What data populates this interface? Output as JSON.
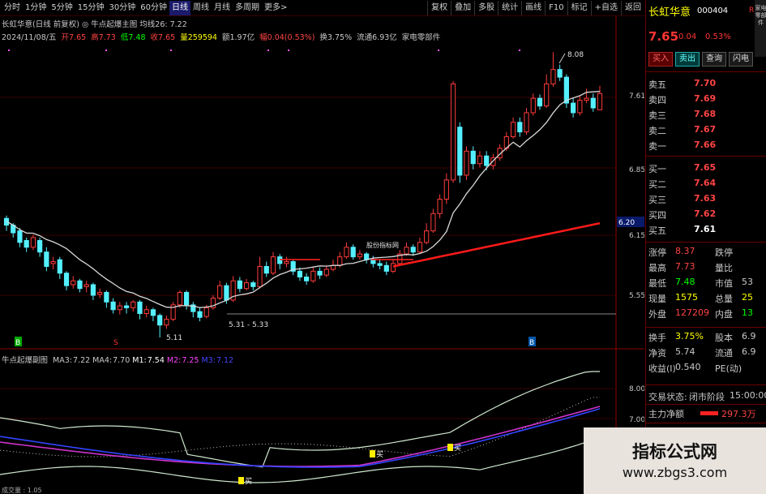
{
  "toolbar": {
    "timeframes": [
      "分时",
      "1分钟",
      "5分钟",
      "15分钟",
      "30分钟",
      "60分钟",
      "日线",
      "周线",
      "月线",
      "多周期",
      "更多>"
    ],
    "active_timeframe": "日线",
    "tools": [
      "复权",
      "叠加",
      "多股",
      "统计",
      "画线",
      "F10",
      "标记",
      "+自选",
      "返回"
    ]
  },
  "main_chart": {
    "header_line": "长虹华意(日线 前复权) ◎ 牛点起爆主图 均线26: 7.22",
    "date": "2024/11/08/五",
    "ohlc": [
      {
        "label": "开",
        "value": "7.65",
        "color": "#ff4444"
      },
      {
        "label": "高",
        "value": "7.73",
        "color": "#ff4444"
      },
      {
        "label": "低",
        "value": "7.48",
        "color": "#00ff00"
      },
      {
        "label": "收",
        "value": "7.65",
        "color": "#ff4444"
      },
      {
        "label": "量",
        "value": "259594",
        "color": "#ffff00"
      },
      {
        "label": "额",
        "value": "1.97亿",
        "color": "#c8c8c8"
      },
      {
        "label": "幅",
        "value": "0.04(0.53%)",
        "color": "#ff4444"
      },
      {
        "label": "换",
        "value": "3.75%",
        "color": "#c8c8c8"
      },
      {
        "label": "流通",
        "value": "6.93亿",
        "color": "#c8c8c8"
      }
    ],
    "industry": "家电零部件",
    "annotations": {
      "high_label": "8.08",
      "low_label": "5.11",
      "range_label": "5.31 - 5.33",
      "signal_label": "股份指标网",
      "marker_left_b": "B",
      "marker_left_s": "S",
      "marker_right_b": "B",
      "price_tag": "6.20"
    },
    "price_axis_labels": [
      "7.61",
      "6.85",
      "6.15",
      "5.55"
    ]
  },
  "sub_chart": {
    "title": "牛点起爆副图",
    "legend": [
      {
        "label": "MA3:",
        "value": "7.22",
        "color": "#c8c8c8"
      },
      {
        "label": "MA4:",
        "value": "7.70",
        "color": "#c8c8c8"
      },
      {
        "label": "M1:",
        "value": "7.54",
        "color": "#ffffff"
      },
      {
        "label": "M2:",
        "value": "7.25",
        "color": "#ff44ff"
      },
      {
        "label": "M3:",
        "value": "7.12",
        "color": "#4444ff"
      }
    ],
    "axis_labels": [
      "8.00",
      "7.00"
    ],
    "signal_text": "买",
    "bottom_text": "成交量 : 1.05"
  },
  "quote_panel": {
    "stock_name": "长虹华意",
    "stock_code": "000404",
    "r_mark": "R",
    "side_label": "家电零部件",
    "price": "7.65",
    "change": "0.04",
    "pct": "0.53%",
    "buttons": [
      "买入",
      "卖出",
      "查询",
      "闪电"
    ],
    "sell_orders": [
      {
        "label": "卖五",
        "price": "7.70"
      },
      {
        "label": "卖四",
        "price": "7.69"
      },
      {
        "label": "卖三",
        "price": "7.68"
      },
      {
        "label": "卖二",
        "price": "7.67"
      },
      {
        "label": "卖一",
        "price": "7.66"
      }
    ],
    "buy_orders": [
      {
        "label": "买一",
        "price": "7.65"
      },
      {
        "label": "买二",
        "price": "7.64"
      },
      {
        "label": "买三",
        "price": "7.63"
      },
      {
        "label": "买四",
        "price": "7.62"
      },
      {
        "label": "买五",
        "price": "7.61"
      }
    ],
    "stats": [
      {
        "l1": "涨停",
        "v1": "8.37",
        "c1": "#ff4444",
        "l2": "跌停",
        "v2": "",
        "c2": "#00ff00"
      },
      {
        "l1": "最高",
        "v1": "7.73",
        "c1": "#ff4444",
        "l2": "量比",
        "v2": "",
        "c2": "#ffff00"
      },
      {
        "l1": "最低",
        "v1": "7.48",
        "c1": "#00ff00",
        "l2": "市值",
        "v2": "53",
        "c2": "#c8c8c8"
      },
      {
        "l1": "现量",
        "v1": "1575",
        "c1": "#ffff00",
        "l2": "总量",
        "v2": "25",
        "c2": "#ffff00"
      },
      {
        "l1": "外盘",
        "v1": "127209",
        "c1": "#ff4444",
        "l2": "内盘",
        "v2": "13",
        "c2": "#00ff00"
      }
    ],
    "stats2": [
      {
        "l1": "换手",
        "v1": "3.75%",
        "c1": "#ffff00",
        "l2": "股本",
        "v2": "6.9",
        "c2": "#c8c8c8"
      },
      {
        "l1": "净资",
        "v1": "5.74",
        "c1": "#c8c8c8",
        "l2": "流通",
        "v2": "6.9",
        "c2": "#c8c8c8"
      },
      {
        "l1": "收益(I)",
        "v1": "0.540",
        "c1": "#c8c8c8",
        "l2": "PE(动)",
        "v2": "",
        "c2": "#c8c8c8"
      }
    ],
    "trade_status_label": "交易状态:",
    "trade_status_value": "闭市阶段",
    "trade_time": "15:00:00",
    "main_flow_label": "主力净额",
    "main_flow_value": "297.3万"
  },
  "watermark": {
    "line1": "指标公式网",
    "line2": "www.zbgs3.com"
  }
}
